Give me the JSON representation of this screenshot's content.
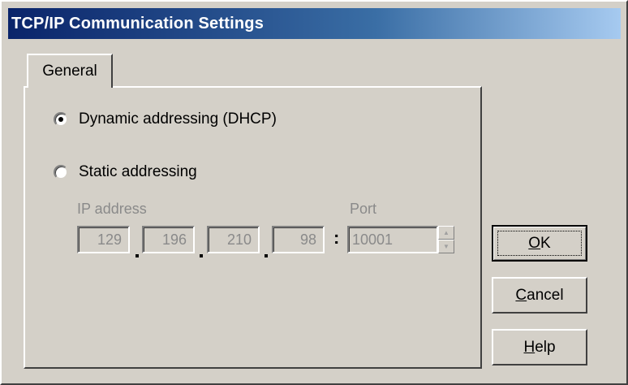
{
  "window": {
    "title": "TCP/IP Communication Settings"
  },
  "tabs": [
    {
      "label": "General",
      "active": true
    }
  ],
  "addressing": {
    "dynamic": {
      "label": "Dynamic addressing (DHCP)",
      "checked": true
    },
    "static": {
      "label": "Static addressing",
      "checked": false
    }
  },
  "ip": {
    "label": "IP address",
    "octets": [
      "129",
      "196",
      "210",
      "98"
    ],
    "separator": ":",
    "enabled": false
  },
  "port": {
    "label": "Port",
    "value": "10001",
    "enabled": false
  },
  "buttons": {
    "ok": {
      "mnemonic": "O",
      "rest": "K"
    },
    "cancel": {
      "mnemonic": "C",
      "rest": "ancel"
    },
    "help": {
      "mnemonic": "H",
      "rest": "elp"
    }
  },
  "icons": {
    "spin_up": "spin-up-arrow-icon",
    "spin_down": "spin-down-arrow-icon"
  }
}
